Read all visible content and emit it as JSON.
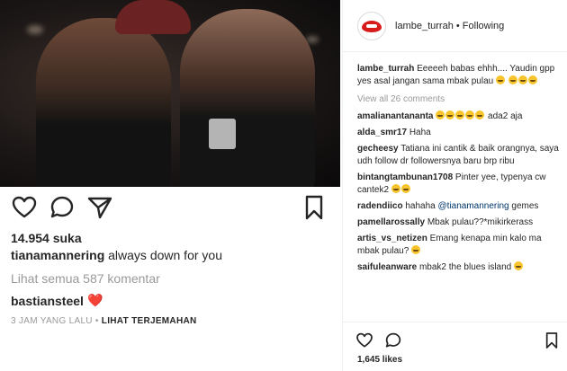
{
  "left_post": {
    "likes": "14.954 suka",
    "caption_user": "tianamannering",
    "caption_text": "always down for you",
    "view_all": "Lihat semua 587 komentar",
    "comment_user": "bastiansteel",
    "comment_emoji": "❤️",
    "time": "3 JAM YANG LALU",
    "separator": " • ",
    "translate": "LIHAT TERJEMAHAN"
  },
  "right_post": {
    "account": "lambe_turrah",
    "follow_separator": " • ",
    "follow_status": "Following",
    "caption_user": "lambe_turrah",
    "caption_text": "Eeeeeh babas ehhh.... Yaudin gpp yes asal jangan sama mbak pulau",
    "view_all": "View all 26 comments",
    "comments": [
      {
        "user": "amalianantananta",
        "text": "ada2 aja"
      },
      {
        "user": "alda_smr17",
        "text": "Haha"
      },
      {
        "user": "gecheesy",
        "text": "Tatiana ini cantik & baik orangnya, saya udh follow dr followersnya baru brp ribu"
      },
      {
        "user": "bintangtambunan1708",
        "text": "Pinter yee, typenya cw cantek2"
      },
      {
        "user": "radendiico",
        "text": "hahaha",
        "mention": "@tianamannering",
        "text2": "gemes"
      },
      {
        "user": "pamellarossally",
        "text": "Mbak pulau??*mikirkerass"
      },
      {
        "user": "artis_vs_netizen",
        "text": "Emang kenapa min kalo ma mbak pulau?"
      },
      {
        "user": "saifuleanware",
        "text": "mbak2 the blues island"
      }
    ],
    "likes": "1,645 likes"
  },
  "icons": {
    "heart": "heart-icon",
    "comment": "comment-icon",
    "share": "send-icon",
    "bookmark": "bookmark-icon"
  },
  "colors": {
    "text": "#262626",
    "muted": "#999999",
    "border": "#efefef",
    "mention": "#003569",
    "accent_red": "#d71a1a"
  }
}
